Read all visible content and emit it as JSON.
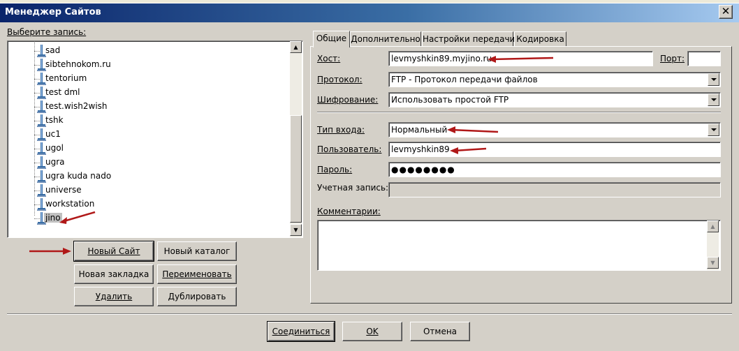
{
  "window": {
    "title": "Менеджер Сайтов",
    "close_glyph": "✕"
  },
  "left": {
    "select_label": "Выберите запись:",
    "sites": [
      "sad",
      "sibtehnokom.ru",
      "tentorium",
      "test dml",
      "test.wish2wish",
      "tshk",
      "uc1",
      "ugol",
      "ugra",
      "ugra kuda nado",
      "universe",
      "workstation",
      "jino"
    ],
    "selected_site": "jino",
    "buttons": {
      "new_site": "Новый Сайт",
      "new_folder": "Новый каталог",
      "new_bookmark": "Новая закладка",
      "rename": "Переименовать",
      "delete": "Удалить",
      "duplicate": "Дублировать"
    }
  },
  "tabs": [
    "Общие",
    "Дополнительно",
    "Настройки передачи",
    "Кодировка"
  ],
  "active_tab": "Общие",
  "general": {
    "host_label": "Хост:",
    "host_value": "levmyshkin89.myjino.ru",
    "port_label": "Порт:",
    "port_value": "",
    "protocol_label": "Протокол:",
    "protocol_value": "FTP - Протокол передачи файлов",
    "encryption_label": "Шифрование:",
    "encryption_value": "Использовать простой FTP",
    "logon_type_label": "Тип входа:",
    "logon_type_value": "Нормальный",
    "user_label": "Пользователь:",
    "user_value": "levmyshkin89",
    "password_label": "Пароль:",
    "password_value": "●●●●●●●●",
    "account_label": "Учетная запись:",
    "account_value": "",
    "comments_label": "Комментарии:",
    "comments_value": ""
  },
  "footer": {
    "connect": "Соединиться",
    "ok": "OK",
    "cancel": "Отмена"
  },
  "colors": {
    "annotation_arrow": "#b01818",
    "title_gradient_start": "#0a246a",
    "title_gradient_end": "#a6caf0"
  },
  "icons": {
    "site": "computer-site-icon",
    "arrow_up": "scroll-up-icon",
    "arrow_down": "scroll-down-icon",
    "dropdown": "chevron-down-icon"
  }
}
